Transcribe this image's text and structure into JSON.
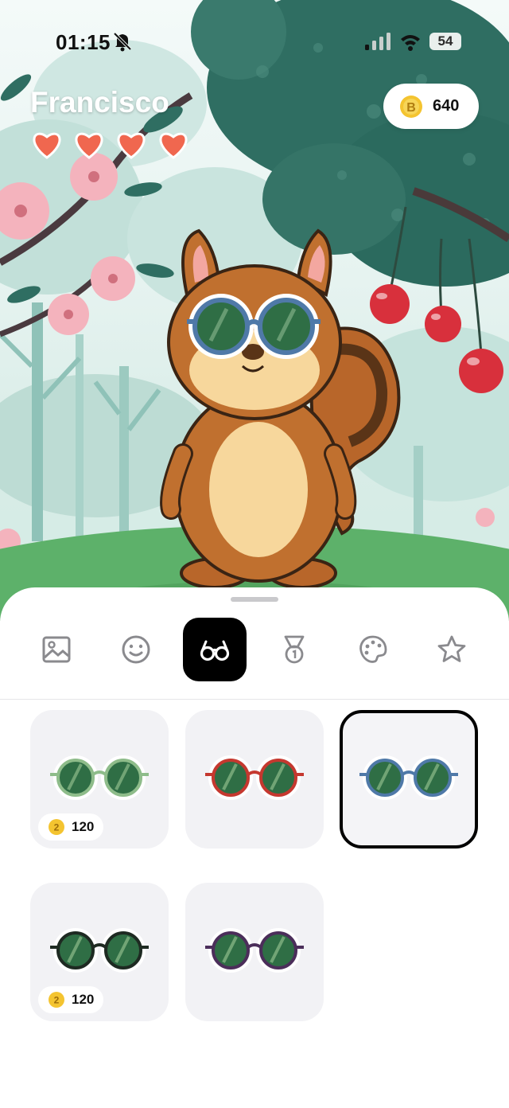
{
  "status_bar": {
    "time": "01:15",
    "battery": "54",
    "icons": [
      "bell-muted-icon",
      "signal-icon",
      "wifi-icon",
      "battery-icon"
    ]
  },
  "player": {
    "name": "Francisco",
    "hearts": 4,
    "coins": "640",
    "coin_icon": "b-coin-icon"
  },
  "tabs": [
    {
      "name": "tab-background",
      "icon": "image-icon",
      "active": false
    },
    {
      "name": "tab-face",
      "icon": "smiley-icon",
      "active": false
    },
    {
      "name": "tab-glasses",
      "icon": "glasses-icon",
      "active": true
    },
    {
      "name": "tab-medals",
      "icon": "medal-icon",
      "active": false
    },
    {
      "name": "tab-colors",
      "icon": "palette-icon",
      "active": false
    },
    {
      "name": "tab-favorites",
      "icon": "star-icon",
      "active": false
    }
  ],
  "items": [
    {
      "name": "green-glasses",
      "frame_color": "#8ebc8a",
      "price": "120",
      "selected": false
    },
    {
      "name": "red-glasses",
      "frame_color": "#c5382f",
      "price": null,
      "selected": false
    },
    {
      "name": "blue-glasses",
      "frame_color": "#4f79a8",
      "price": null,
      "selected": true
    },
    {
      "name": "black-glasses",
      "frame_color": "#1e2a22",
      "price": "120",
      "selected": false
    },
    {
      "name": "purple-glasses",
      "frame_color": "#4b2e5a",
      "price": null,
      "selected": false
    }
  ],
  "colors": {
    "accent_active_tab": "#000000",
    "heart": "#f0674f",
    "coin": "#f4c430"
  }
}
